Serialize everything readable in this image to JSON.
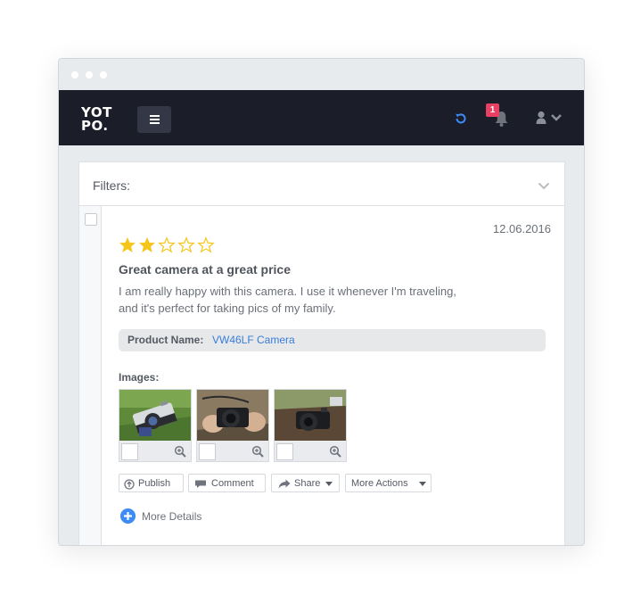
{
  "app": {
    "logo_line1": "YOT",
    "logo_line2": "PO.",
    "notification_count": "1"
  },
  "filters": {
    "label": "Filters:"
  },
  "review": {
    "date": "12.06.2016",
    "rating": 2,
    "rating_max": 5,
    "title": "Great camera at a great price",
    "body_line1": "I am really happy with this camera. I use it whenever I'm traveling,",
    "body_line2": "and it's perfect for taking pics of my family.",
    "product_label": "Product Name:",
    "product_value": "VW46LF Camera",
    "images_label": "Images:",
    "actions": {
      "publish": "Publish",
      "comment": "Comment",
      "share": "Share",
      "more_actions": "More Actions"
    },
    "more_details": "More Details"
  },
  "colors": {
    "navbar": "#1b1d28",
    "accent_blue": "#3d8bf5",
    "badge": "#e84062",
    "star": "#f5c518"
  }
}
